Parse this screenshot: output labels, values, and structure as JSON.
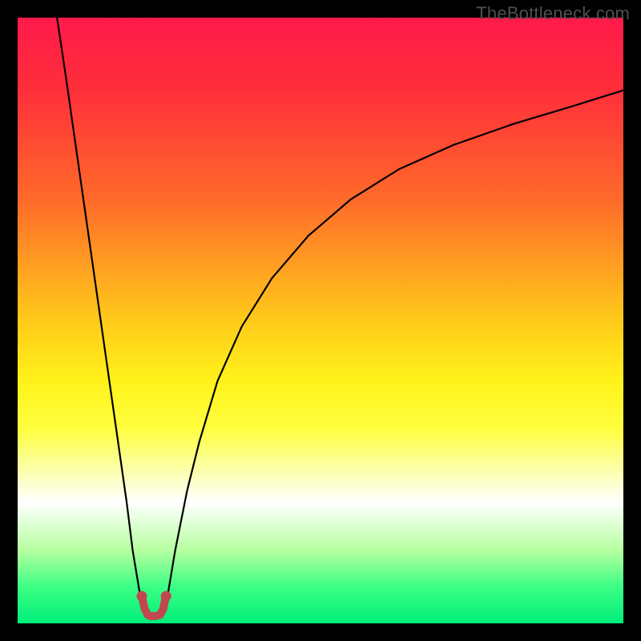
{
  "watermark": "TheBottleneck.com",
  "chart_data": {
    "type": "line",
    "title": "",
    "xlabel": "",
    "ylabel": "",
    "xlim": [
      0,
      100
    ],
    "ylim": [
      0,
      100
    ],
    "gradient_stops": [
      {
        "offset": 0.0,
        "color": "#ff1a4a"
      },
      {
        "offset": 0.12,
        "color": "#ff2f3a"
      },
      {
        "offset": 0.3,
        "color": "#ff6a2a"
      },
      {
        "offset": 0.5,
        "color": "#ffca1a"
      },
      {
        "offset": 0.6,
        "color": "#fff21a"
      },
      {
        "offset": 0.68,
        "color": "#ffff40"
      },
      {
        "offset": 0.75,
        "color": "#fbffb0"
      },
      {
        "offset": 0.8,
        "color": "#ffffff"
      },
      {
        "offset": 0.88,
        "color": "#b6ffa0"
      },
      {
        "offset": 0.94,
        "color": "#3bff84"
      },
      {
        "offset": 1.0,
        "color": "#00ee7a"
      }
    ],
    "series": [
      {
        "name": "left-branch",
        "color": "#000000",
        "width": 2.2,
        "x": [
          6.5,
          8,
          10,
          12,
          14,
          16,
          18,
          19,
          20,
          20.5
        ],
        "y": [
          100,
          90,
          76,
          62,
          48,
          34,
          20,
          12,
          6,
          3
        ]
      },
      {
        "name": "right-branch",
        "color": "#000000",
        "width": 2.2,
        "x": [
          24.5,
          25,
          26,
          28,
          30,
          33,
          37,
          42,
          48,
          55,
          63,
          72,
          82,
          92,
          100
        ],
        "y": [
          3,
          6,
          12,
          22,
          30,
          40,
          49,
          57,
          64,
          70,
          75,
          79,
          82.5,
          85.5,
          88
        ]
      },
      {
        "name": "valley-marker",
        "color": "#c1474f",
        "width": 10,
        "linecap": "round",
        "x": [
          20.5,
          21,
          21.5,
          22,
          22.7,
          23.5,
          24,
          24.5
        ],
        "y": [
          4.5,
          2.3,
          1.4,
          1.2,
          1.2,
          1.4,
          2.3,
          4.5
        ]
      }
    ],
    "valley_endpoints": [
      {
        "x": 20.5,
        "y": 4.5
      },
      {
        "x": 24.5,
        "y": 4.5
      }
    ]
  }
}
